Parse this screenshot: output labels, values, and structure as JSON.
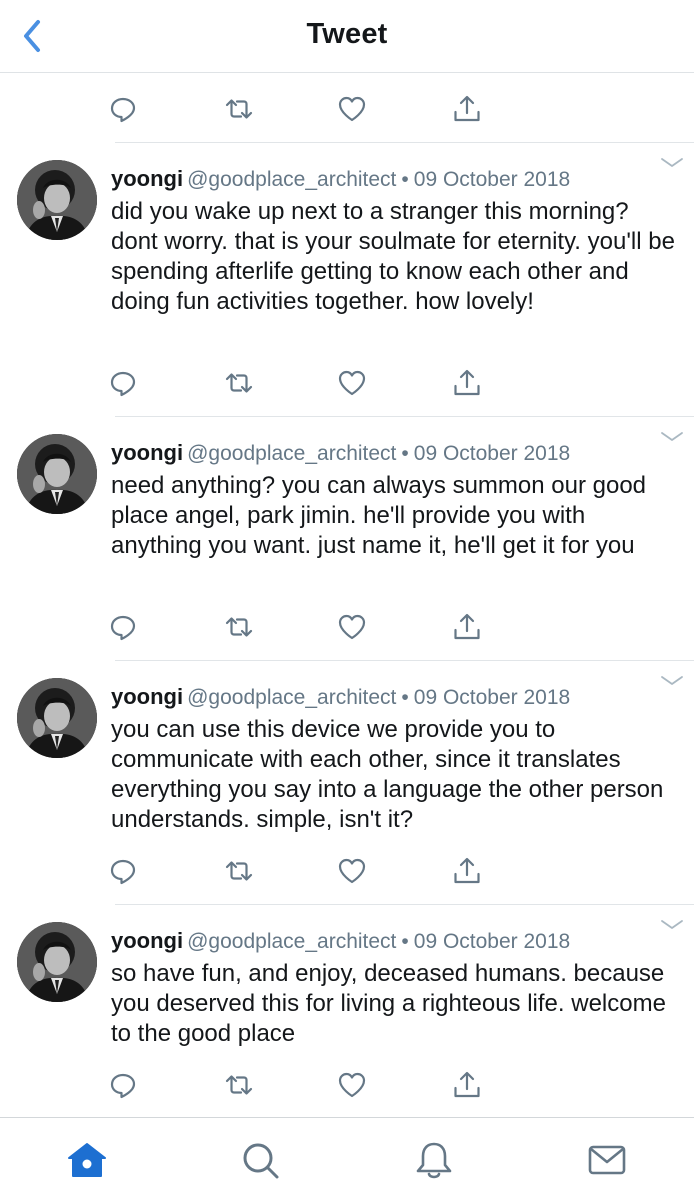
{
  "header": {
    "title": "Tweet",
    "back_icon": "chevron-left-icon"
  },
  "colors": {
    "accent": "#4a90e2",
    "icon_gray": "#657786",
    "divider": "#e1e5e8",
    "text": "#14171a"
  },
  "tweets": [
    {
      "name": "yoongi",
      "handle": "@goodplace_architect",
      "separator": "•",
      "date": "09 October 2018",
      "text": "did you wake up next to a stranger this morning? dont worry. that is your soulmate for eternity. you'll be spending afterlife getting to know each other and doing fun activities together. how lovely!"
    },
    {
      "name": "yoongi",
      "handle": "@goodplace_architect",
      "separator": "•",
      "date": "09 October 2018",
      "text": "need anything? you can always summon our good place angel, park jimin. he'll provide you with anything you want. just name it, he'll get it for you"
    },
    {
      "name": "yoongi",
      "handle": "@goodplace_architect",
      "separator": "•",
      "date": "09 October 2018",
      "text": "you can use this device we provide you to communicate with each other, since it translates everything you say into a language the other person understands. simple, isn't it?"
    },
    {
      "name": "yoongi",
      "handle": "@goodplace_architect",
      "separator": "•",
      "date": "09 October 2018",
      "text": "so have fun, and enjoy, deceased humans. because you deserved this for living a righteous life. welcome to the good place"
    }
  ],
  "action_icons": [
    "reply-icon",
    "retweet-icon",
    "like-icon",
    "share-icon"
  ],
  "tabbar": {
    "items": [
      "home-icon",
      "search-icon",
      "notifications-icon",
      "messages-icon"
    ],
    "active": "home-icon"
  }
}
